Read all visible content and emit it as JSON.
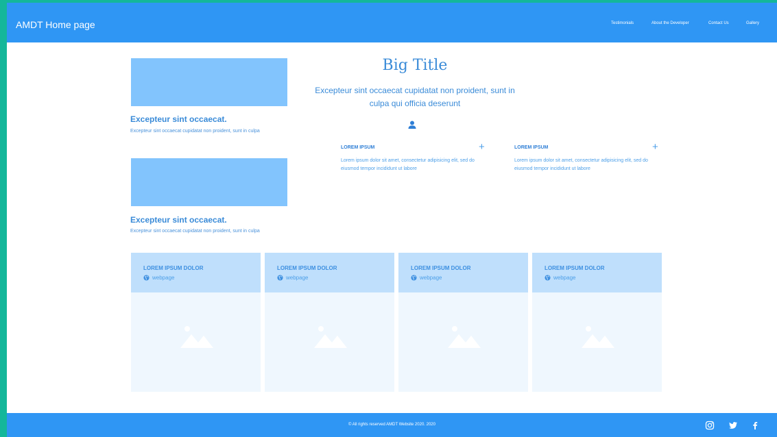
{
  "header": {
    "brand": "AMDT Home page",
    "nav": [
      "Testimonials",
      "About the Developer",
      "Contact Us",
      "Gallery"
    ]
  },
  "side_cards": [
    {
      "title": "Excepteur sint occaecat.",
      "text": "Excepteur sint occaecat cupidatat non proident, sunt in culpa"
    },
    {
      "title": "Excepteur sint occaecat.",
      "text": "Excepteur sint occaecat cupidatat non proident, sunt in culpa"
    }
  ],
  "hero": {
    "title": "Big Title",
    "subtitle": "Excepteur sint occaecat cupidatat non proident, sunt in culpa qui officia deserunt",
    "icon": "user-icon"
  },
  "features": [
    {
      "heading": "LOREM IPSUM",
      "body": "Lorem ipsum dolor sit amet, consectetur adipisicing elit, sed do eiusmod tempor incididunt ut labore",
      "icon": "plus-icon"
    },
    {
      "heading": "LOREM IPSUM",
      "body": "Lorem ipsum dolor sit amet, consectetur adipisicing elit, sed do eiusmod tempor incididunt ut labore",
      "icon": "plus-icon"
    }
  ],
  "tiles": [
    {
      "title": "LOREM IPSUM DOLOR",
      "link": "webpage"
    },
    {
      "title": "LOREM IPSUM DOLOR",
      "link": "webpage"
    },
    {
      "title": "LOREM IPSUM DOLOR",
      "link": "webpage"
    },
    {
      "title": "LOREM IPSUM DOLOR",
      "link": "webpage"
    }
  ],
  "footer": {
    "copyright": "© All rights reserved AMDT Website 2020. 2020",
    "social": [
      "instagram-icon",
      "twitter-icon",
      "facebook-icon"
    ]
  },
  "colors": {
    "accent": "#2f96f4",
    "side_border": "#14b79a",
    "card_image": "#82c4fd",
    "tile_header": "#bfdffc",
    "tile_body": "#eff7fe"
  }
}
